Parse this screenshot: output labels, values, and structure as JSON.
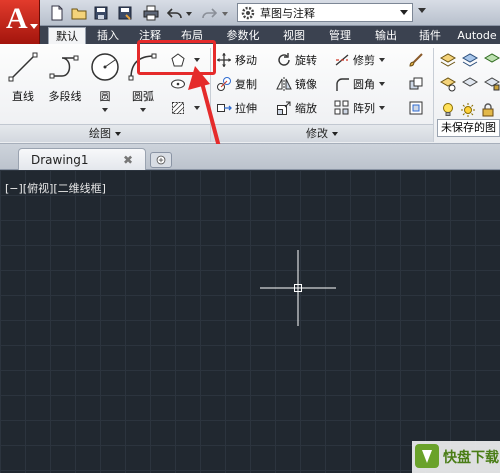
{
  "colors": {
    "accent": "#e52b2b",
    "canvas_bg": "#212830",
    "tab_bar": "#3b4250"
  },
  "titlebar": {
    "logo_letter": "A",
    "workspace": "草图与注释",
    "quick_access_icons": [
      "new-file-icon",
      "open-folder-icon",
      "save-icon",
      "save-as-icon",
      "print-icon",
      "undo-icon",
      "redo-icon"
    ]
  },
  "tabs": [
    "默认",
    "插入",
    "注释",
    "布局",
    "参数化",
    "视图",
    "管理",
    "输出",
    "插件",
    "Autode"
  ],
  "draw_panel": {
    "tools": [
      "直线",
      "多段线",
      "圆",
      "圆弧"
    ],
    "footer": "绘图"
  },
  "modify_panel": {
    "tools": [
      "移动",
      "旋转",
      "修剪",
      "复制",
      "镜像",
      "圆角",
      "拉伸",
      "缩放",
      "阵列"
    ],
    "footer": "修改"
  },
  "layer_panel": {
    "current_layer": "未保存的图"
  },
  "file_tab": {
    "name": "Drawing1",
    "close": "✖"
  },
  "viewport": {
    "label": "[−][俯视][二维线框]"
  },
  "watermark": {
    "brand": "快盘下载"
  }
}
